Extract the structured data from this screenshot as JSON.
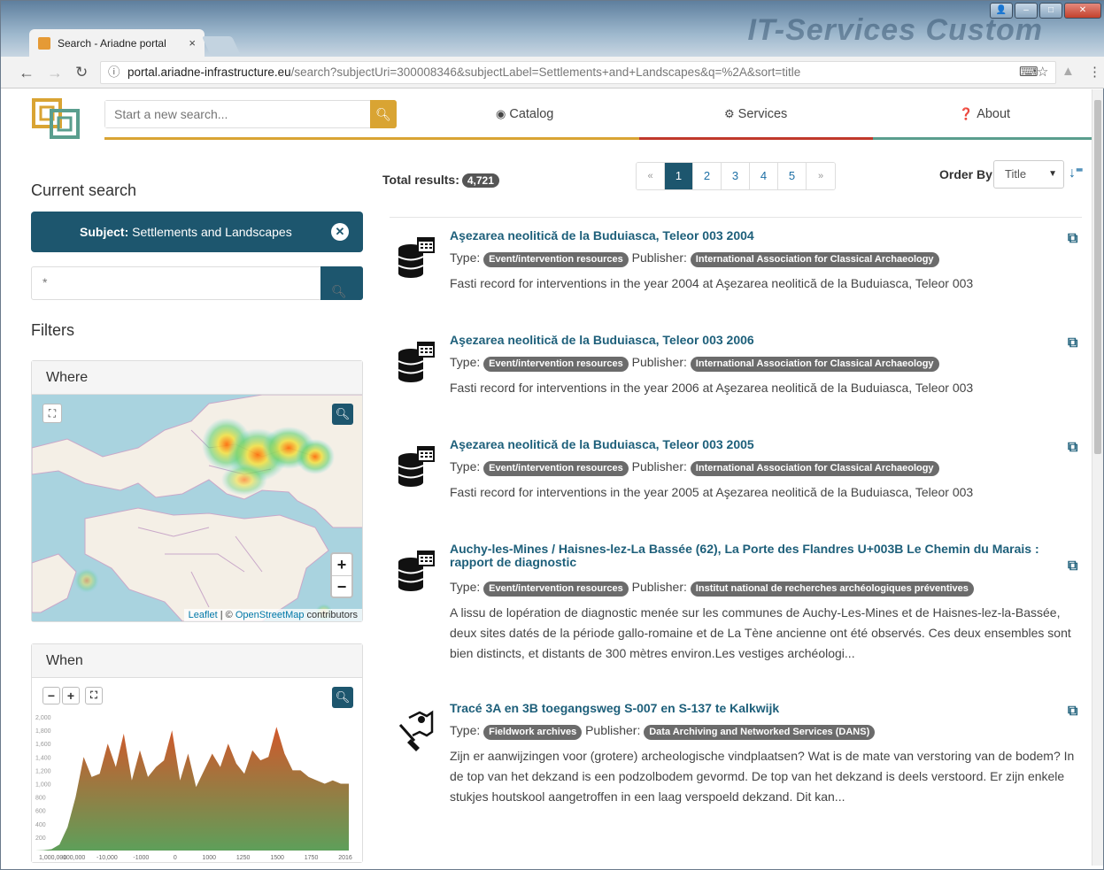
{
  "browser": {
    "tab_title": "Search - Ariadne portal",
    "tab_close": "×",
    "url_host": "portal.ariadne-infrastructure.eu",
    "url_path": "/search?subjectUri=300008346&subjectLabel=Settlements+and+Landscapes&q=%2A&sort=title",
    "brand_text": "IT-Services Custom"
  },
  "header": {
    "search_placeholder": "Start a new search...",
    "nav": [
      {
        "label": "Catalog",
        "icon": "globe-icon"
      },
      {
        "label": "Services",
        "icon": "gear-icon"
      },
      {
        "label": "About",
        "icon": "question-circle-icon"
      }
    ],
    "line_colors": [
      "#d9a433",
      "#c0392b",
      "#5a9e8e"
    ]
  },
  "sidebar": {
    "current_search_title": "Current search",
    "subject_label": "Subject:",
    "subject_value": "Settlements and Landscapes",
    "query_value": "*",
    "filters_title": "Filters",
    "where_title": "Where",
    "map_attribution_leaflet": "Leaflet",
    "map_attribution_sep": " | © ",
    "map_attribution_osm": "OpenStreetMap",
    "map_attribution_suffix": " contributors",
    "when_title": "When"
  },
  "chart_data": {
    "type": "area",
    "x": [
      "1,000,000",
      "-100,000",
      "-10,000",
      "-1000",
      "0",
      "1000",
      "1250",
      "1500",
      "1750",
      "2016"
    ],
    "y_ticks": [
      "2,000",
      "1,800",
      "1,600",
      "1,400",
      "1,200",
      "1,000",
      "800",
      "600",
      "400",
      "200"
    ],
    "ylim": [
      0,
      2000
    ],
    "series": [
      {
        "values": [
          0,
          5,
          20,
          90,
          350,
          800,
          1400,
          1100,
          1150,
          1600,
          1250,
          1750,
          1050,
          1500,
          1100,
          1250,
          1350,
          1800,
          1050,
          1450,
          950,
          1200,
          1450,
          1250,
          1600,
          1300,
          1150,
          1500,
          1350,
          1400,
          1850,
          1450,
          1200,
          1200,
          1100,
          1050,
          1000,
          1050,
          1000,
          1000
        ]
      }
    ],
    "colors": {
      "top": "#d2572a",
      "bottom": "#5e9f5a"
    }
  },
  "results_header": {
    "total_label": "Total results:",
    "total_count": "4,721",
    "pages": [
      "«",
      "1",
      "2",
      "3",
      "4",
      "5",
      "»"
    ],
    "active_page": "1",
    "order_by_label": "Order By",
    "order_by_value": "Title"
  },
  "results": [
    {
      "title": "Aşezarea neolitică de la Buduiasca, Teleor 003 2004",
      "type_label": "Type:",
      "type": "Event/intervention resources",
      "publisher_label": "Publisher:",
      "publisher": "International Association for Classical Archaeology",
      "description": "Fasti record for interventions in the year 2004 at Aşezarea neolitică de la Buduiasca, Teleor 003",
      "icon": "database-calendar-icon"
    },
    {
      "title": "Aşezarea neolitică de la Buduiasca, Teleor 003 2006",
      "type_label": "Type:",
      "type": "Event/intervention resources",
      "publisher_label": "Publisher:",
      "publisher": "International Association for Classical Archaeology",
      "description": "Fasti record for interventions in the year 2006 at Aşezarea neolitică de la Buduiasca, Teleor 003",
      "icon": "database-calendar-icon"
    },
    {
      "title": "Aşezarea neolitică de la Buduiasca, Teleor 003 2005",
      "type_label": "Type:",
      "type": "Event/intervention resources",
      "publisher_label": "Publisher:",
      "publisher": "International Association for Classical Archaeology",
      "description": "Fasti record for interventions in the year 2005 at Aşezarea neolitică de la Buduiasca, Teleor 003",
      "icon": "database-calendar-icon"
    },
    {
      "title": "Auchy-les-Mines / Haisnes-lez-La Bassée (62), La Porte des Flandres U+003B Le Chemin du Marais : rapport de diagnostic",
      "type_label": "Type:",
      "type": "Event/intervention resources",
      "publisher_label": "Publisher:",
      "publisher": "Institut national de recherches archéologiques préventives",
      "description": "A lissu de lopération de diagnostic menée sur les communes de Auchy-Les-Mines et de Haisnes-lez-la-Bassée, deux sites datés de la période gallo-romaine et de La Tène ancienne ont été observés. Ces deux ensembles sont bien distincts, et distants de 300 mètres environ.Les vestiges archéologi...",
      "icon": "database-calendar-icon"
    },
    {
      "title": "Tracé 3A en 3B toegangsweg S-007 en S-137 te Kalkwijk",
      "type_label": "Type:",
      "type": "Fieldwork archives",
      "publisher_label": "Publisher:",
      "publisher": "Data Archiving and Networked Services (DANS)",
      "description": "Zijn er aanwijzingen voor (grotere) archeologische vindplaatsen? Wat is de mate van verstoring van de bodem? In de top van het dekzand is een podzolbodem gevormd. De top van het dekzand is deels verstoord. Er zijn enkele stukjes houtskool aangetroffen in een laag verspoeld dekzand. Dit kan...",
      "icon": "shovel-map-icon"
    }
  ]
}
